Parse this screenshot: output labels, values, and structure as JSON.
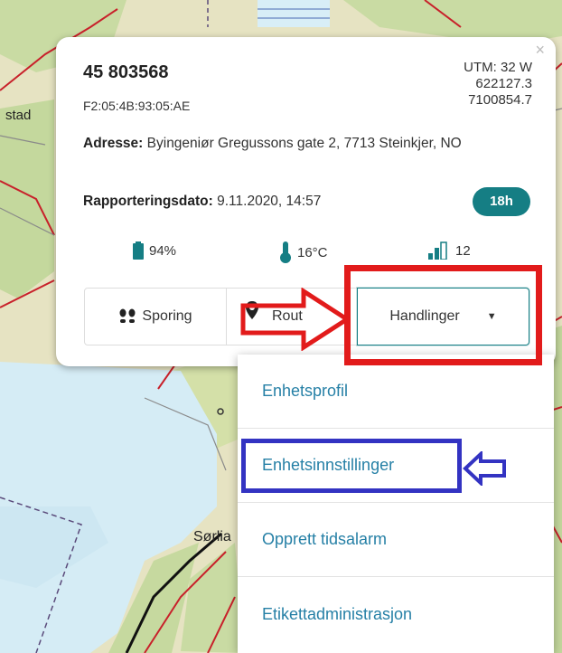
{
  "map": {
    "labels": {
      "stad": "stad",
      "sorlia": "Sørlia"
    }
  },
  "popup": {
    "device_id": "45 803568",
    "mac": "F2:05:4B:93:05:AE",
    "utm_zone": "UTM: 32 W",
    "utm_easting": "622127.3",
    "utm_northing": "7100854.7",
    "address_label": "Adresse:",
    "address_value": "Byingeniør Gregussons gate 2, 7713 Steinkjer, NO",
    "report_label": "Rapporteringsdato:",
    "report_value": "9.11.2020, 14:57",
    "age_badge": "18h",
    "battery": "94%",
    "temperature": "16°C",
    "signal": "12",
    "buttons": {
      "tracking": "Sporing",
      "route": "Rout",
      "actions": "Handlinger"
    },
    "close_symbol": "×"
  },
  "dropdown": {
    "items": [
      "Enhetsprofil",
      "Enhetsinnstillinger",
      "Opprett tidsalarm",
      "Etikettadministrasjon"
    ]
  },
  "colors": {
    "accent": "#157e84",
    "link": "#2680a6",
    "annotation_red": "#e21b1b",
    "annotation_blue": "#3333c2"
  },
  "icons": [
    "battery-icon",
    "thermometer-icon",
    "signal-icon",
    "footprints-icon",
    "route-pin-icon",
    "caret-down-icon",
    "arrow-right-icon",
    "arrow-left-icon"
  ]
}
